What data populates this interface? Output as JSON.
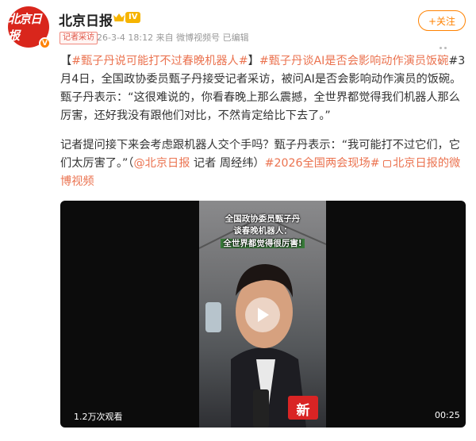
{
  "account": {
    "name": "北京日报",
    "avatar_text": "北京日报",
    "level": "IV",
    "verified_badge": "V",
    "tag": "记者采访",
    "meta": "26-3-4 18:12  来自 微博视频号 已编辑",
    "follow_label": "+关注"
  },
  "post": {
    "bracket_open": "【",
    "topic1": "#甄子丹说可能打不过春晚机器人#",
    "bracket_close": "】",
    "topic2": "#甄子丹谈AI是否会影响动作演员饭碗",
    "para1_rest": "#3月4日，全国政协委员甄子丹接受记者采访，被问AI是否会影响动作演员的饭碗。甄子丹表示：“这很难说的，你看春晚上那么震撼，全世界都觉得我们机器人那么厉害，还好我没有跟他们对比，不然肯定给比下去了。”",
    "para2_text": "记者提问接下来会考虑跟机器人交个手吗？甄子丹表示：“我可能打不过它们，它们太厉害了。”（",
    "mention": "@北京日报",
    "reporter": " 记者 周经纬）",
    "topic3": "#2026全国两会现场#",
    "channel": "北京日报的微博视频"
  },
  "video": {
    "caption_line1": "全国政协委员甄子丹",
    "caption_line2": "谈春晚机器人：",
    "caption_line3": "全世界都觉得很厉害!",
    "mic_text": "新",
    "views": "1.2万次观看",
    "duration": "00:25"
  },
  "icons": [
    "crown-icon",
    "more-icon",
    "play-icon",
    "channel-icon"
  ],
  "colors": {
    "brand_red": "#d9261c",
    "link": "#eb7350",
    "follow": "#ff8200"
  }
}
